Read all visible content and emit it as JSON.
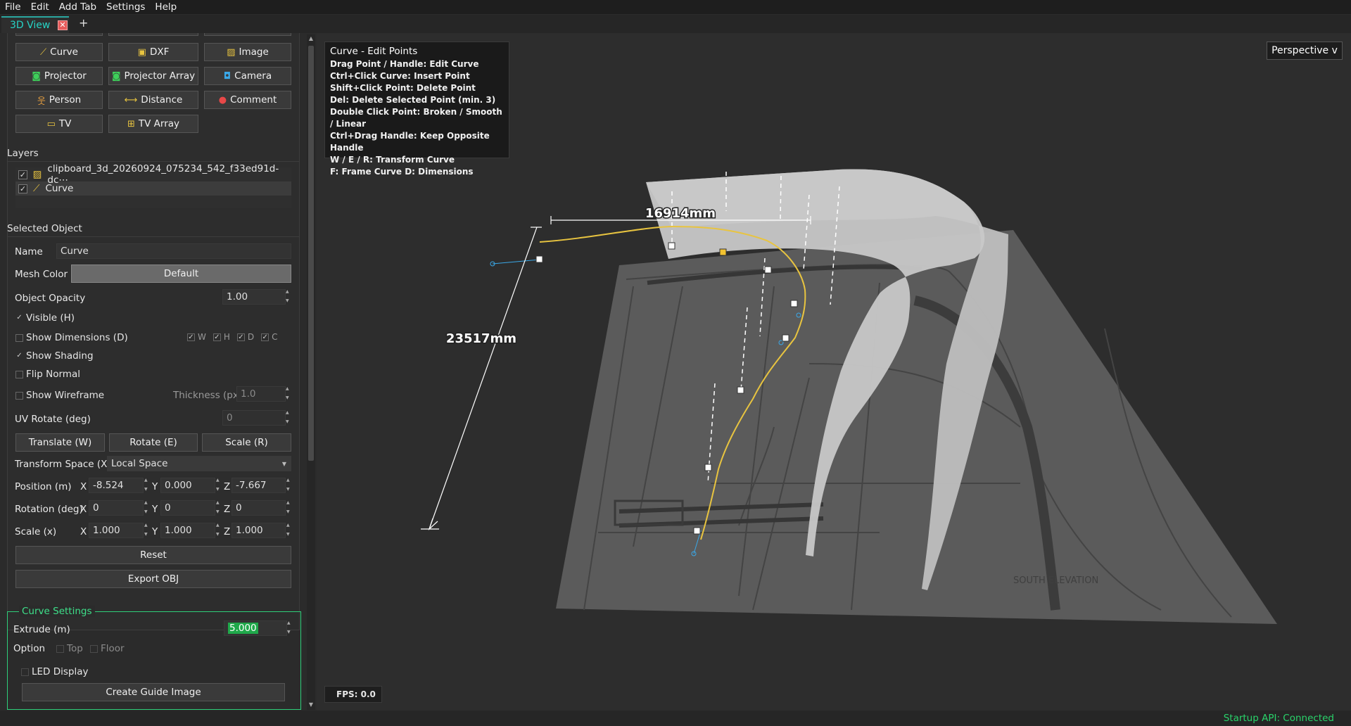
{
  "menu": [
    "File",
    "Edit",
    "Add Tab",
    "Settings",
    "Help"
  ],
  "tabs": {
    "active": "3D View",
    "add": "+"
  },
  "toolbar": {
    "buttons": [
      {
        "label": "Curve",
        "icon": "curve-icon"
      },
      {
        "label": "DXF",
        "icon": "dxf-icon"
      },
      {
        "label": "Image",
        "icon": "image-icon"
      },
      {
        "label": "Projector",
        "icon": "projector-icon"
      },
      {
        "label": "Projector Array",
        "icon": "projector-array-icon"
      },
      {
        "label": "Camera",
        "icon": "camera-icon"
      },
      {
        "label": "Person",
        "icon": "person-icon"
      },
      {
        "label": "Distance",
        "icon": "distance-icon"
      },
      {
        "label": "Comment",
        "icon": "comment-icon"
      },
      {
        "label": "TV",
        "icon": "tv-icon"
      },
      {
        "label": "TV Array",
        "icon": "tv-array-icon"
      }
    ]
  },
  "layers": {
    "title": "Layers",
    "items": [
      {
        "label": "clipboard_3d_20260924_075234_542_f33ed91d-dc⋯",
        "checked": true
      },
      {
        "label": "Curve",
        "checked": true
      }
    ]
  },
  "selected_object": {
    "title": "Selected Object",
    "name_label": "Name",
    "name_value": "Curve",
    "mesh_color_label": "Mesh Color",
    "mesh_color_value": "Default",
    "opacity_label": "Object Opacity",
    "opacity_value": "1.00",
    "visible_label": "Visible (H)",
    "show_dimensions_label": "Show Dimensions (D)",
    "dim_flags": [
      "W",
      "H",
      "D",
      "C"
    ],
    "show_shading_label": "Show Shading",
    "flip_normal_label": "Flip Normal",
    "show_wireframe_label": "Show Wireframe",
    "thickness_label": "Thickness (px)",
    "thickness_value": "1.0",
    "uv_rotate_label": "UV Rotate (deg)",
    "uv_rotate_value": "0",
    "translate_label": "Translate (W)",
    "rotate_label": "Rotate (E)",
    "scale_label": "Scale (R)",
    "transform_space_label": "Transform Space (X)",
    "transform_space_value": "Local Space",
    "position_label": "Position (m)",
    "position": {
      "x": "-8.524",
      "y": "0.000",
      "z": "-7.667"
    },
    "rotation_label": "Rotation (deg)",
    "rotation": {
      "x": "0",
      "y": "0",
      "z": "0"
    },
    "scale_row_label": "Scale (x)",
    "scale": {
      "x": "1.000",
      "y": "1.000",
      "z": "1.000"
    },
    "axis_x": "X",
    "axis_y": "Y",
    "axis_z": "Z",
    "reset_label": "Reset",
    "export_label": "Export OBJ"
  },
  "curve_settings": {
    "title": "Curve Settings",
    "extrude_label": "Extrude (m)",
    "extrude_value": "5.000",
    "option_label": "Option",
    "top_label": "Top",
    "floor_label": "Floor",
    "led_label": "LED Display",
    "guide_label": "Create Guide Image"
  },
  "viewport": {
    "help_title": "Curve - Edit Points",
    "help_lines": [
      "Drag Point / Handle: Edit Curve",
      "Ctrl+Click Curve: Insert Point",
      "Shift+Click Point: Delete Point",
      "Del: Delete Selected Point (min. 3)",
      "Double Click Point: Broken / Smooth / Linear",
      "Ctrl+Drag Handle: Keep Opposite Handle",
      "W / E / R: Transform Curve",
      "F: Frame Curve   D: Dimensions"
    ],
    "perspective_label": "Perspective v",
    "dimension_width": "16914mm",
    "dimension_depth": "23517mm",
    "fps": "FPS: 0.0",
    "watermark": "SOUTH ELEVATION"
  },
  "status": "Startup API: Connected",
  "colors": {
    "accent": "#26d3c5",
    "curve_settings_border": "#2ecf7a",
    "status_ok": "#29d36a",
    "selected_point": "#f2c230",
    "curve_line": "#e8c440"
  }
}
